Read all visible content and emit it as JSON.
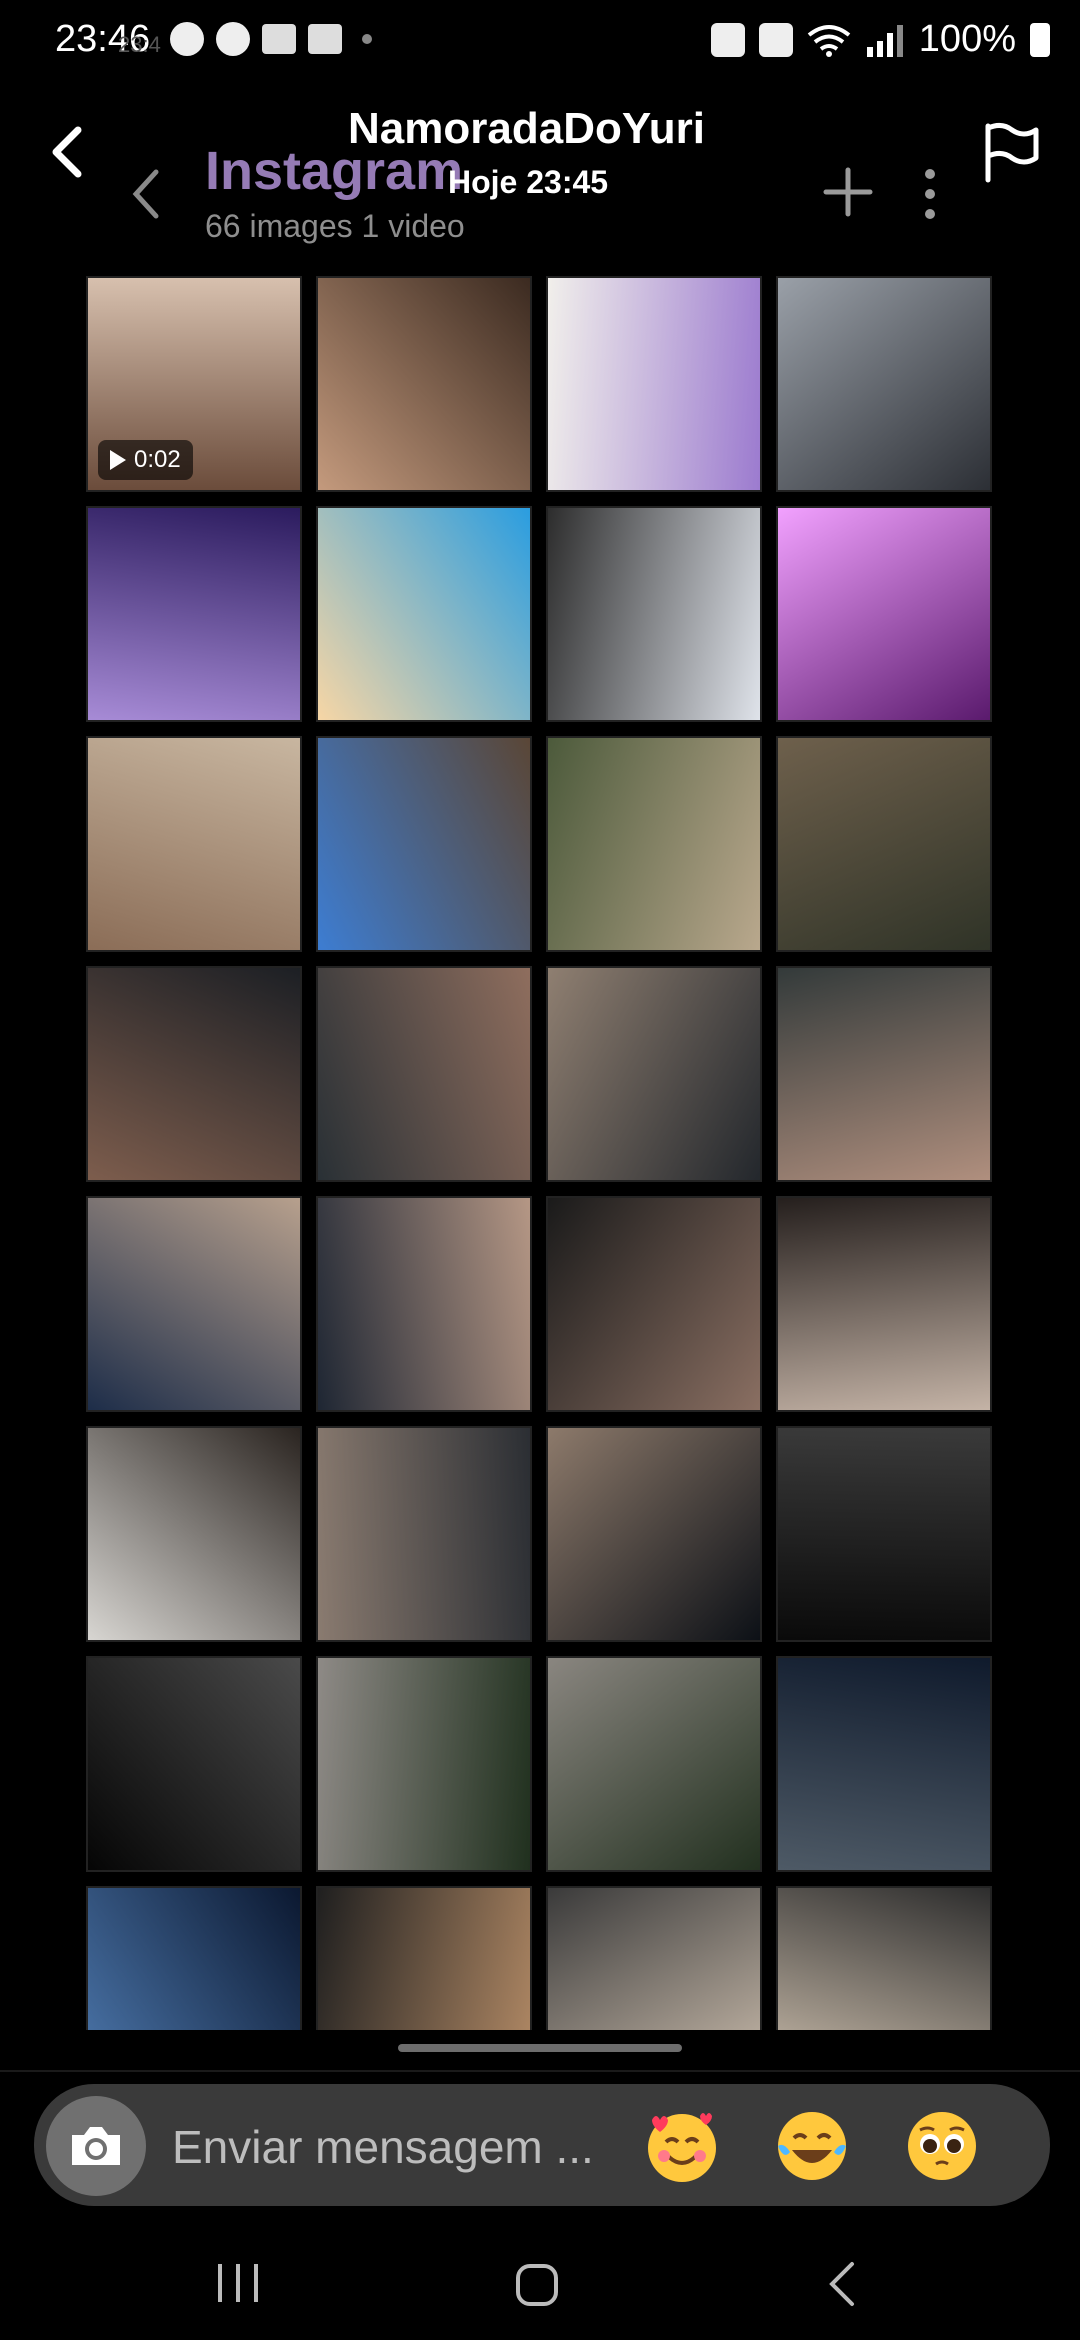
{
  "status_bar": {
    "time": "23:46",
    "ghost_time": "23:4",
    "battery": "100%"
  },
  "header": {
    "title": "NamoradaDoYuri",
    "subtitle": "Hoje 23:45",
    "back_icon": "back-arrow-icon",
    "flag_icon": "flag-icon"
  },
  "shared_screen": {
    "app_title": "Instagram",
    "count": "66 images 1 video"
  },
  "gallery": {
    "video_duration": "0:02",
    "tiles": [
      {
        "c1": "#6b4c3b",
        "c2": "#d7c0ae",
        "video": true
      },
      {
        "c1": "#c49a7d",
        "c2": "#3b2a20",
        "video": false
      },
      {
        "c1": "#f1efeb",
        "c2": "#9c7bcf",
        "video": false
      },
      {
        "c1": "#9aa0a8",
        "c2": "#2c2f35",
        "video": false
      },
      {
        "c1": "#2b1b5e",
        "c2": "#a78bd6",
        "video": false
      },
      {
        "c1": "#2a9de0",
        "c2": "#f7d6a5",
        "video": false
      },
      {
        "c1": "#dfe3ea",
        "c2": "#2d2d2d",
        "video": false
      },
      {
        "c1": "#5a1a6d",
        "c2": "#f2a1ff",
        "video": false
      },
      {
        "c1": "#8b6d57",
        "c2": "#c8b6a0",
        "video": false
      },
      {
        "c1": "#3d7dd2",
        "c2": "#5a4636",
        "video": false
      },
      {
        "c1": "#4c5a3b",
        "c2": "#b9a88d",
        "video": false
      },
      {
        "c1": "#6e604c",
        "c2": "#2f3327",
        "video": false
      },
      {
        "c1": "#1c1f24",
        "c2": "#7d5d4d",
        "video": false
      },
      {
        "c1": "#8f6e5e",
        "c2": "#293035",
        "video": false
      },
      {
        "c1": "#23272c",
        "c2": "#8f7f71",
        "video": false
      },
      {
        "c1": "#b08f7e",
        "c2": "#333a3a",
        "video": false
      },
      {
        "c1": "#1d2d49",
        "c2": "#b7a08d",
        "video": false
      },
      {
        "c1": "#1e2633",
        "c2": "#b59785",
        "video": false
      },
      {
        "c1": "#1a1a1a",
        "c2": "#8a6f62",
        "video": false
      },
      {
        "c1": "#251f1d",
        "c2": "#c4b3a6",
        "video": false
      },
      {
        "c1": "#2a2420",
        "c2": "#d8d6d2",
        "video": false
      },
      {
        "c1": "#2b2e33",
        "c2": "#8a7b70",
        "video": false
      },
      {
        "c1": "#0c1016",
        "c2": "#8d7a6b",
        "video": false
      },
      {
        "c1": "#0a0a0a",
        "c2": "#3a3a3a",
        "video": false
      },
      {
        "c1": "#050505",
        "c2": "#4a4a4a",
        "video": false
      },
      {
        "c1": "#8e8a86",
        "c2": "#20301e",
        "video": false
      },
      {
        "c1": "#8a8680",
        "c2": "#22301f",
        "video": false
      },
      {
        "c1": "#0f1a2c",
        "c2": "#4e5a66",
        "video": false
      },
      {
        "c1": "#0b1830",
        "c2": "#4e7ab0",
        "video": false
      },
      {
        "c1": "#b48b66",
        "c2": "#1f1f1f",
        "video": false
      },
      {
        "c1": "#d2c3b2",
        "c2": "#3a3a3a",
        "video": false
      },
      {
        "c1": "#d8c9b6",
        "c2": "#2d2d2d",
        "video": false
      }
    ]
  },
  "composer": {
    "placeholder": "Enviar mensagem ...",
    "camera_icon": "camera-icon",
    "emojis": [
      "smiling-face-with-hearts-emoji",
      "tears-of-joy-emoji",
      "pleading-face-emoji"
    ]
  },
  "nav": {
    "recent_icon": "recent-apps-icon",
    "home_icon": "home-icon",
    "back_icon": "back-icon"
  }
}
